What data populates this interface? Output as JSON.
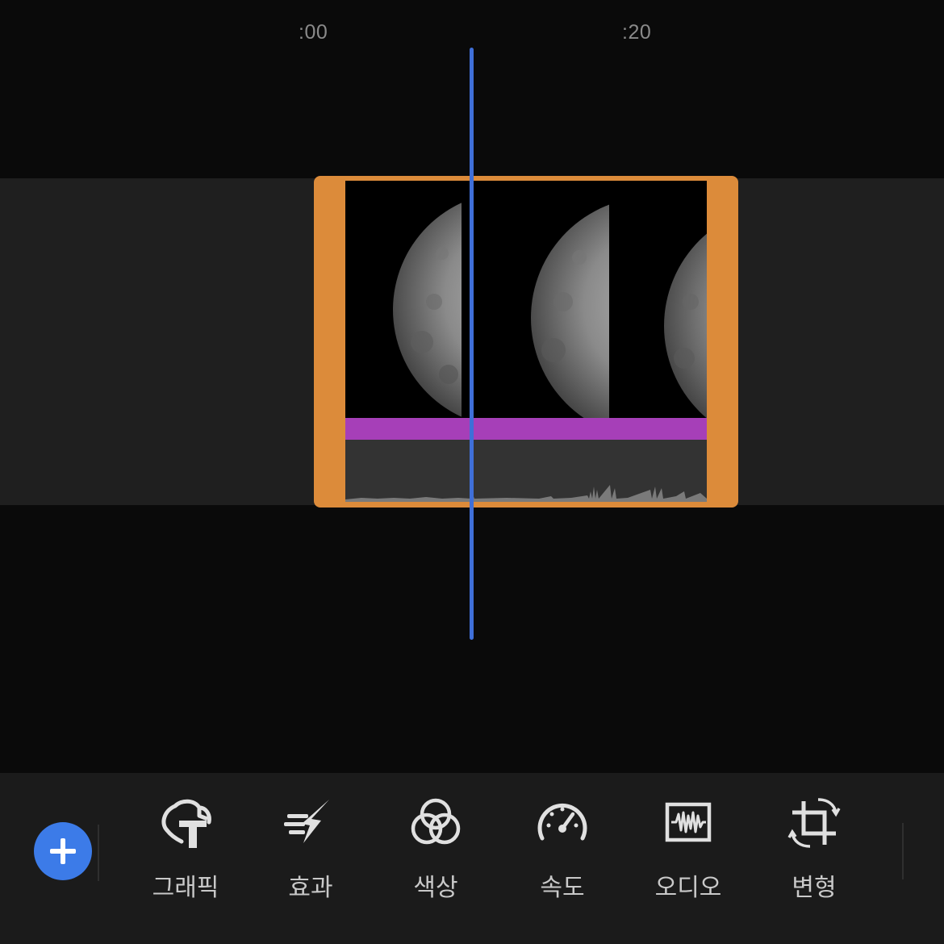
{
  "ruler": {
    "marks": [
      ":00",
      ":20"
    ]
  },
  "clip": {
    "trim_color": "#dc8b3a",
    "effect_bar_color": "#a63fb8",
    "thumbnail_subject": "moon"
  },
  "playhead_color": "#3f6fd8",
  "toolbar": {
    "add_icon": "plus-icon",
    "tools": [
      {
        "label": "그래픽",
        "icon": "graphics-title-icon"
      },
      {
        "label": "효과",
        "icon": "effects-lightning-icon"
      },
      {
        "label": "색상",
        "icon": "color-circles-icon"
      },
      {
        "label": "속도",
        "icon": "speed-gauge-icon"
      },
      {
        "label": "오디오",
        "icon": "audio-waveform-icon"
      },
      {
        "label": "변형",
        "icon": "transform-crop-icon"
      }
    ]
  },
  "accent_color": "#3c7be8"
}
